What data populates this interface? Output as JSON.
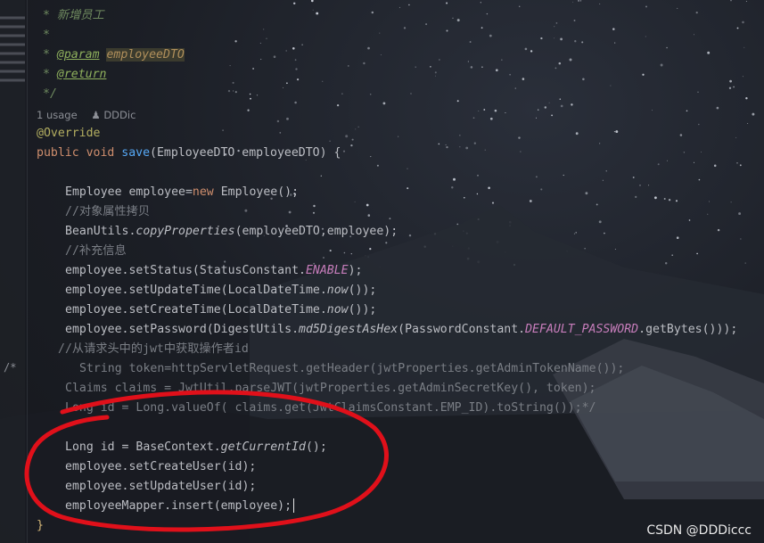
{
  "code_lines": {
    "l1": "* 新增员工",
    "l2": "*",
    "l3_a": "* ",
    "l3_tag": "@param",
    "l3_param": "employeeDTO",
    "l4_a": "* ",
    "l4_tag": "@return",
    "l5": "*/",
    "l6_ann": "@Override",
    "l7_kw": "public void ",
    "l7_fn": "save",
    "l7_rest": "(EmployeeDTO employeeDTO) {",
    "l8_a": "Employee employee=",
    "l8_kw": "new",
    "l8_b": " Employee();",
    "l9": "//对象属性拷贝",
    "l10_a": "BeanUtils.",
    "l10_fn": "copyProperties",
    "l10_b": "(employeeDTO,employee);",
    "l11": "//补充信息",
    "l12_a": "employee.setStatus(StatusConstant.",
    "l12_static": "ENABLE",
    "l12_b": ");",
    "l13_a": "employee.setUpdateTime(LocalDateTime.",
    "l13_fn": "now",
    "l13_b": "());",
    "l14_a": "employee.setCreateTime(LocalDateTime.",
    "l14_fn": "now",
    "l14_b": "());",
    "l15_a": "employee.setPassword(DigestUtils.",
    "l15_fn": "md5DigestAsHex",
    "l15_b": "(PasswordConstant.",
    "l15_static": "DEFAULT_PASSWORD",
    "l15_c": ".getBytes()));",
    "l16": "//从请求头中的jwt中获取操作者id",
    "l17_mark": "/*",
    "l17": "String token=httpServletRequest.getHeader(jwtProperties.getAdminTokenName());",
    "l18": "Claims claims = JwtUtil.parseJWT(jwtProperties.getAdminSecretKey(), token);",
    "l19": "Long id = Long.valueOf( claims.get(JwtClaimsConstant.EMP_ID).toString());*/",
    "l20_a": "Long id = BaseContext.",
    "l20_fn": "getCurrentId",
    "l20_b": "();",
    "l21": "employee.setCreateUser(id);",
    "l22": "employee.setUpdateUser(id);",
    "l23": "employeeMapper.insert(employee);",
    "l24": "}"
  },
  "hint": {
    "usage": "1 usage",
    "author": "DDDic"
  },
  "watermark": "CSDN @DDDiccc",
  "colors": {
    "annotation_circle": "#e0101a",
    "background": "#1c1f26",
    "keyword": "#cf8e6d",
    "method": "#56a8f5",
    "static_field": "#c77dbb",
    "comment": "#6f8a5f"
  }
}
